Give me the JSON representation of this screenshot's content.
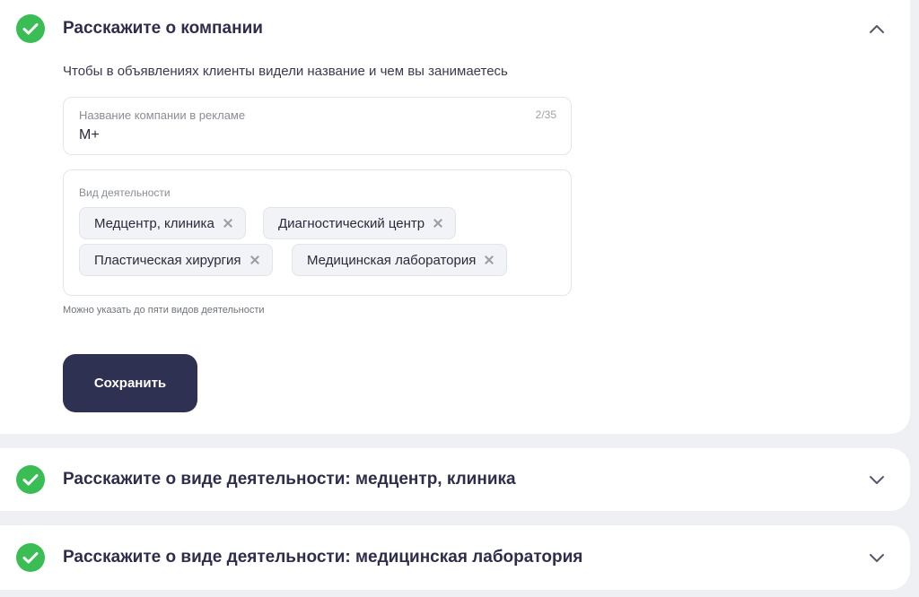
{
  "sections": [
    {
      "title": "Расскажите о компании",
      "status_icon": "check-circle-icon",
      "expanded": true,
      "chevron_icon": "chevron-up-icon"
    },
    {
      "title": "Расскажите о виде деятельности: медцентр, клиника",
      "status_icon": "check-circle-icon",
      "expanded": false,
      "chevron_icon": "chevron-down-icon"
    },
    {
      "title": "Расскажите о виде деятельности: медицинская лаборатория",
      "status_icon": "check-circle-icon",
      "expanded": false,
      "chevron_icon": "chevron-down-icon"
    }
  ],
  "company_form": {
    "subtitle": "Чтобы в объявлениях клиенты видели название и чем вы занимаетесь",
    "name_field": {
      "label": "Название компании в рекламе",
      "counter": "2/35",
      "value": "М+"
    },
    "activity_field": {
      "label": "Вид деятельности",
      "chips": [
        "Медцентр, клиника",
        "Диагностический центр",
        "Пластическая хирургия",
        "Медицинская лаборатория"
      ],
      "remove_icon": "close-icon"
    },
    "hint": "Можно указать до пяти видов деятельности",
    "save_label": "Сохранить"
  },
  "colors": {
    "page_background": "#eef0f4",
    "card_background": "#ffffff",
    "success": "#3bbd55",
    "primary_button": "#2e3152",
    "title_text": "#2e2d4b"
  }
}
